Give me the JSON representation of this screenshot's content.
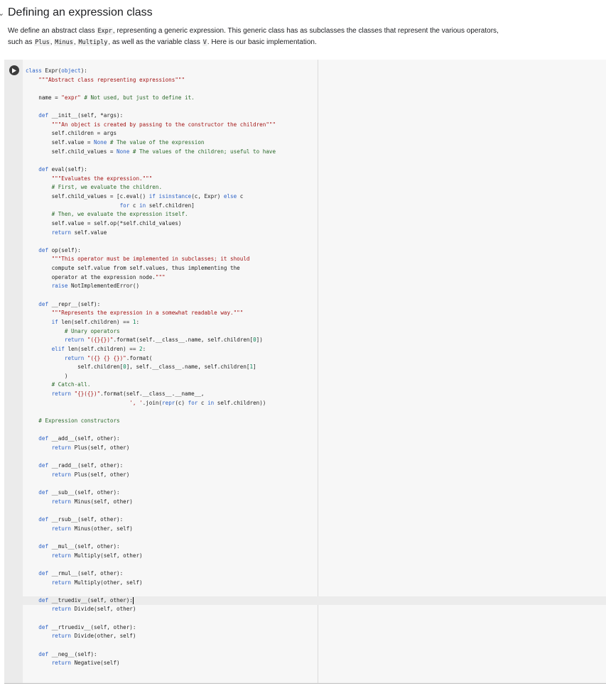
{
  "section": {
    "toggle_glyph": "⌄",
    "title": "Defining an expression class"
  },
  "text_cell": {
    "p1": "We define an abstract class ",
    "c1": "Expr",
    "p2": ", representing a generic expression. This generic class has as subclasses the classes that represent the various operators, such as ",
    "c2": "Plus",
    "p3": ", ",
    "c3": "Minus",
    "p4": ", ",
    "c4": "Multiply",
    "p5": ", as well as the variable class ",
    "c5": "V",
    "p6": ". Here is our basic implementation."
  },
  "code_lines": [
    "class Expr(object):",
    "    \"\"\"Abstract class representing expressions\"\"\"",
    "",
    "    name = \"expr\" # Not used, but just to define it.",
    "",
    "    def __init__(self, *args):",
    "        \"\"\"An object is created by passing to the constructor the children\"\"\"",
    "        self.children = args",
    "        self.value = None # The value of the expression",
    "        self.child_values = None # The values of the children; useful to have",
    "",
    "    def eval(self):",
    "        \"\"\"Evaluates the expression.\"\"\"",
    "        # First, we evaluate the children.",
    "        self.child_values = [c.eval() if isinstance(c, Expr) else c",
    "                             for c in self.children]",
    "        # Then, we evaluate the expression itself.",
    "        self.value = self.op(*self.child_values)",
    "        return self.value",
    "",
    "    def op(self):",
    "        \"\"\"This operator must be implemented in subclasses; it should",
    "        compute self.value from self.values, thus implementing the",
    "        operator at the expression node.\"\"\"",
    "        raise NotImplementedError()",
    "",
    "    def __repr__(self):",
    "        \"\"\"Represents the expression in a somewhat readable way.\"\"\"",
    "        if len(self.children) == 1:",
    "            # Unary operators",
    "            return \"({}{})\".format(self.__class__.name, self.children[0])",
    "        elif len(self.children) == 2:",
    "            return \"({} {} {})\".format(",
    "                self.children[0], self.__class__.name, self.children[1]",
    "            )",
    "        # Catch-all.",
    "        return \"{}({})\".format(self.__class__.__name__,",
    "                                ', '.join(repr(c) for c in self.children))",
    "",
    "    # Expression constructors",
    "",
    "    def __add__(self, other):",
    "        return Plus(self, other)",
    "",
    "    def __radd__(self, other):",
    "        return Plus(self, other)",
    "",
    "    def __sub__(self, other):",
    "        return Minus(self, other)",
    "",
    "    def __rsub__(self, other):",
    "        return Minus(other, self)",
    "",
    "    def __mul__(self, other):",
    "        return Multiply(self, other)",
    "",
    "    def __rmul__(self, other):",
    "        return Multiply(other, self)",
    "",
    "    def __truediv__(self, other):",
    "        return Divide(self, other)",
    "",
    "    def __rtruediv__(self, other):",
    "        return Divide(other, self)",
    "",
    "    def __neg__(self):",
    "        return Negative(self)"
  ],
  "cursor_line": 59,
  "icons": {
    "run": "play-circle-icon"
  },
  "colors": {
    "keyword": "#2c62c7",
    "string": "#a31515",
    "comment": "#2b6a2b",
    "number": "#098658"
  }
}
